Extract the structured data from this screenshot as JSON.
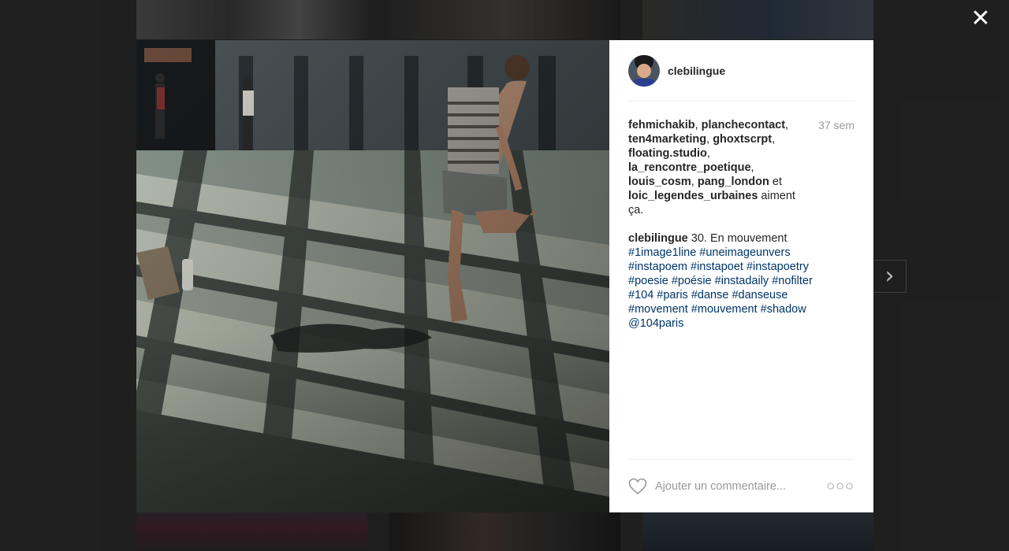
{
  "post": {
    "username": "clebilingue",
    "time": "37 sem",
    "likers": [
      "fehmichakib",
      "planchecontact",
      "ten4marketing",
      "ghoxtscrpt",
      "floating.studio",
      "la_rencontre_poetique",
      "louis_cosm",
      "pang_london",
      "loic_legendes_urbaines"
    ],
    "likes_text_et": " et ",
    "likes_text_suffix": " aiment ça.",
    "caption_author": "clebilingue",
    "caption_text": " 30. En mouvement ",
    "hashtags": [
      "#1image1line",
      "#uneimageunvers",
      "#instapoem",
      "#instapoet",
      "#instapoetry",
      "#poesie",
      "#poésie",
      "#instadaily",
      "#nofilter",
      "#104",
      "#paris",
      "#danse",
      "#danseuse",
      "#movement",
      "#mouvement",
      "#shadow",
      "@104paris"
    ]
  },
  "comment": {
    "placeholder": "Ajouter un commentaire..."
  },
  "controls": {
    "close_glyph": "✕",
    "next_glyph": "›",
    "more_glyph": "○○○"
  },
  "icons": {
    "close": "close-icon",
    "next": "chevron-right-icon",
    "like": "heart-icon",
    "more": "more-options-icon"
  }
}
